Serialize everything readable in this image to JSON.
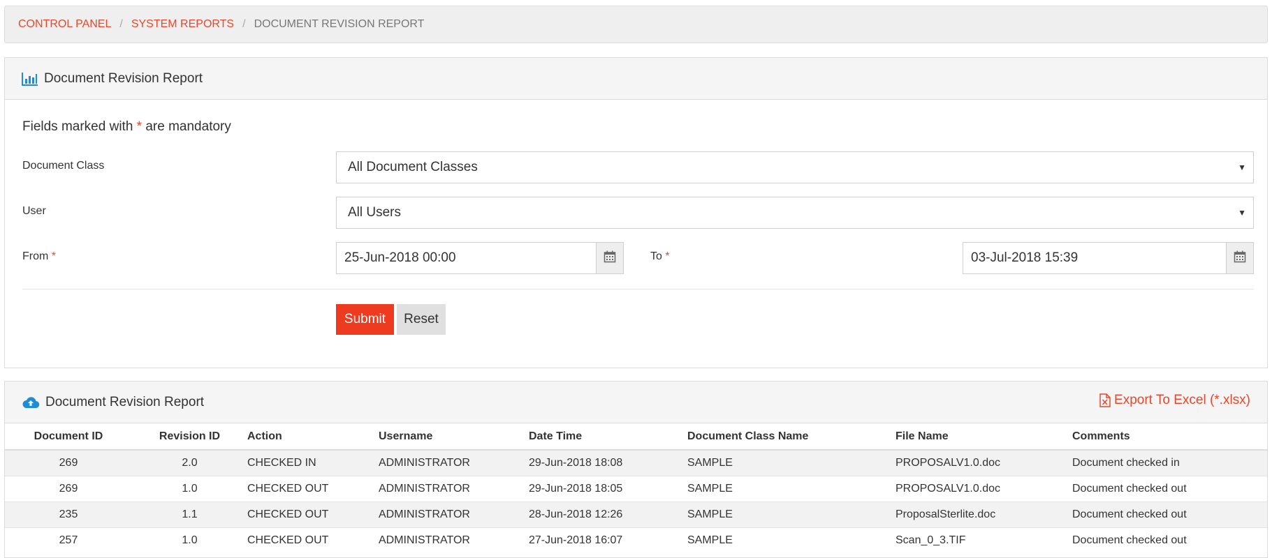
{
  "breadcrumb": {
    "items": [
      "CONTROL PANEL",
      "SYSTEM REPORTS"
    ],
    "current": "DOCUMENT REVISION REPORT",
    "separator": "/"
  },
  "form": {
    "title": "Document Revision Report",
    "mandatory_prefix": "Fields marked with",
    "mandatory_star": "*",
    "mandatory_suffix": "are mandatory",
    "document_class_label": "Document Class",
    "document_class_value": "All Document Classes",
    "user_label": "User",
    "user_value": "All Users",
    "from_label": "From",
    "from_value": "25-Jun-2018 00:00",
    "to_label": "To",
    "to_value": "03-Jul-2018 15:39",
    "submit_label": "Submit",
    "reset_label": "Reset",
    "required_star": "*"
  },
  "results": {
    "title": "Document Revision Report",
    "export_label": "Export To Excel (*.xlsx)",
    "columns": [
      "Document ID",
      "Revision ID",
      "Action",
      "Username",
      "Date Time",
      "Document Class Name",
      "File Name",
      "Comments"
    ],
    "rows": [
      [
        "269",
        "2.0",
        "CHECKED IN",
        "ADMINISTRATOR",
        "29-Jun-2018 18:08",
        "SAMPLE",
        "PROPOSALV1.0.doc",
        "Document checked in"
      ],
      [
        "269",
        "1.0",
        "CHECKED OUT",
        "ADMINISTRATOR",
        "29-Jun-2018 18:05",
        "SAMPLE",
        "PROPOSALV1.0.doc",
        "Document checked out"
      ],
      [
        "235",
        "1.1",
        "CHECKED OUT",
        "ADMINISTRATOR",
        "28-Jun-2018 12:26",
        "SAMPLE",
        "ProposalSterlite.doc",
        "Document checked out"
      ],
      [
        "257",
        "1.0",
        "CHECKED OUT",
        "ADMINISTRATOR",
        "27-Jun-2018 16:07",
        "SAMPLE",
        "Scan_0_3.TIF",
        "Document checked out"
      ]
    ]
  },
  "icons": {
    "report": "bar-chart-icon",
    "results": "cloud-upload-icon",
    "export": "excel-file-icon",
    "calendar": "calendar-icon",
    "dropdown": "caret-down-icon"
  },
  "colors": {
    "accent": "#e8472c",
    "submit": "#ee3a1e",
    "icon_blue": "#1f8dd6"
  }
}
